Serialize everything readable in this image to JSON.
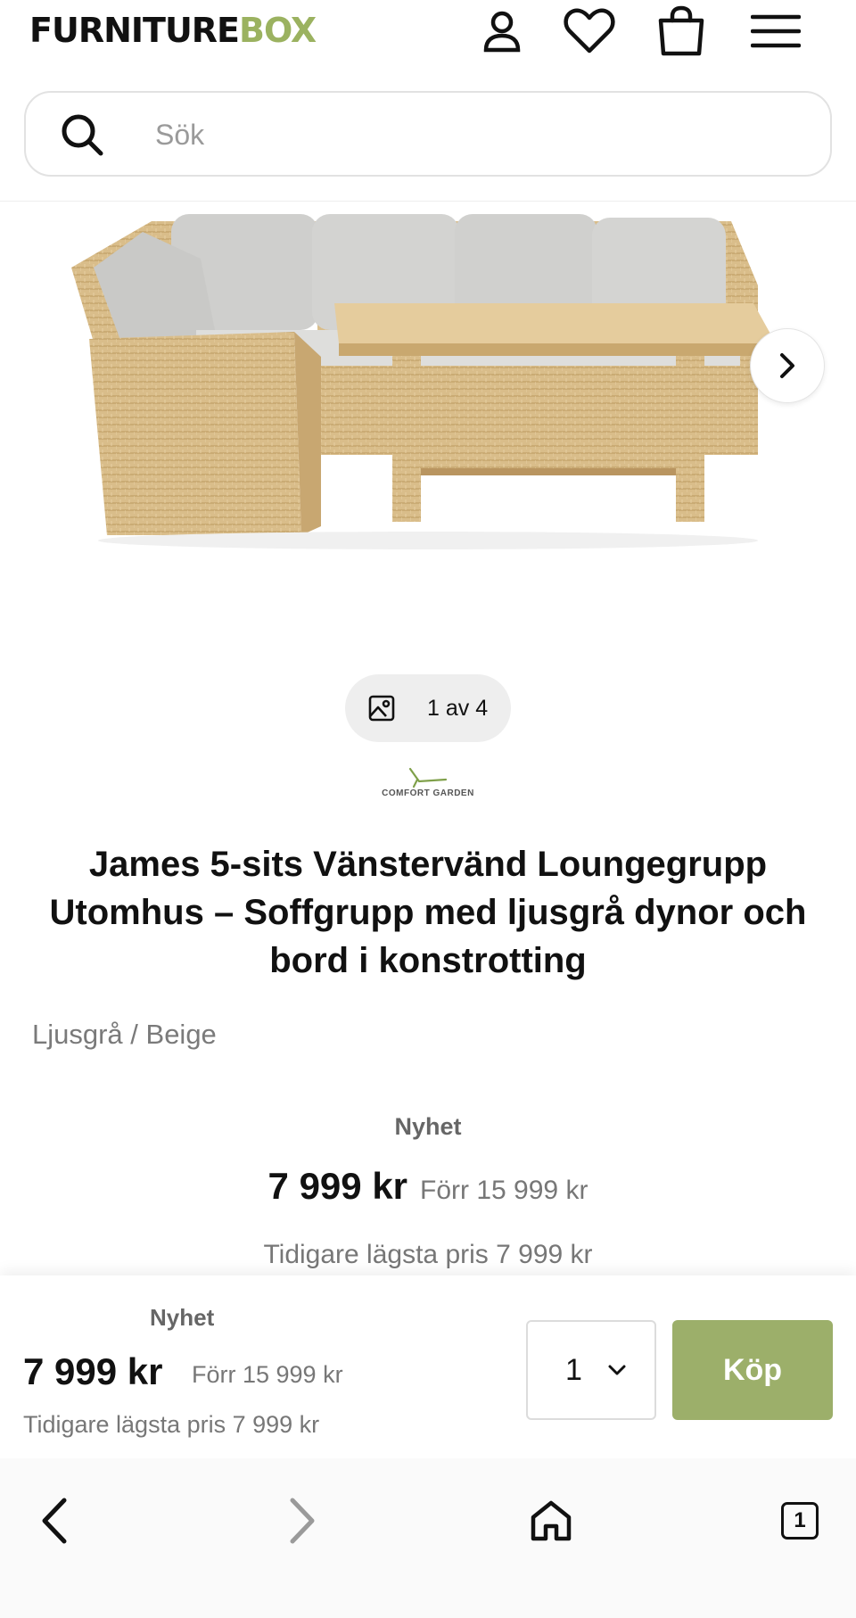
{
  "header": {
    "logo_part1": "FURNITURE",
    "logo_part2": "BOX",
    "icons": [
      "user-icon",
      "heart-icon",
      "bag-icon",
      "menu-icon"
    ],
    "brand_color": "#9bb260"
  },
  "search": {
    "placeholder": "Sök",
    "value": ""
  },
  "gallery": {
    "counter": "1 av 4",
    "next_icon": "chevron-right-icon"
  },
  "product": {
    "brand": "COMFORT GARDEN",
    "title": "James 5-sits Vänstervänd Loungegrupp Utomhus – Soffgrupp med ljusgrå dynor och bord i konstrotting",
    "variant": "Ljusgrå / Beige",
    "badge": "Nyhet",
    "price": "7 999 kr",
    "old_price": "Förr 15 999 kr",
    "lowest_price": "Tidigare lägsta pris 7 999 kr"
  },
  "buybar": {
    "badge": "Nyhet",
    "price": "7 999 kr",
    "old_price": "Förr 15 999 kr",
    "lowest_price": "Tidigare lägsta pris 7 999 kr",
    "quantity": "1",
    "buy_label": "Köp",
    "buy_color": "#9caf6a"
  },
  "toolbar": {
    "tab_count": "1",
    "icons": [
      "back-icon",
      "forward-icon",
      "home-icon",
      "tabs-icon"
    ]
  }
}
